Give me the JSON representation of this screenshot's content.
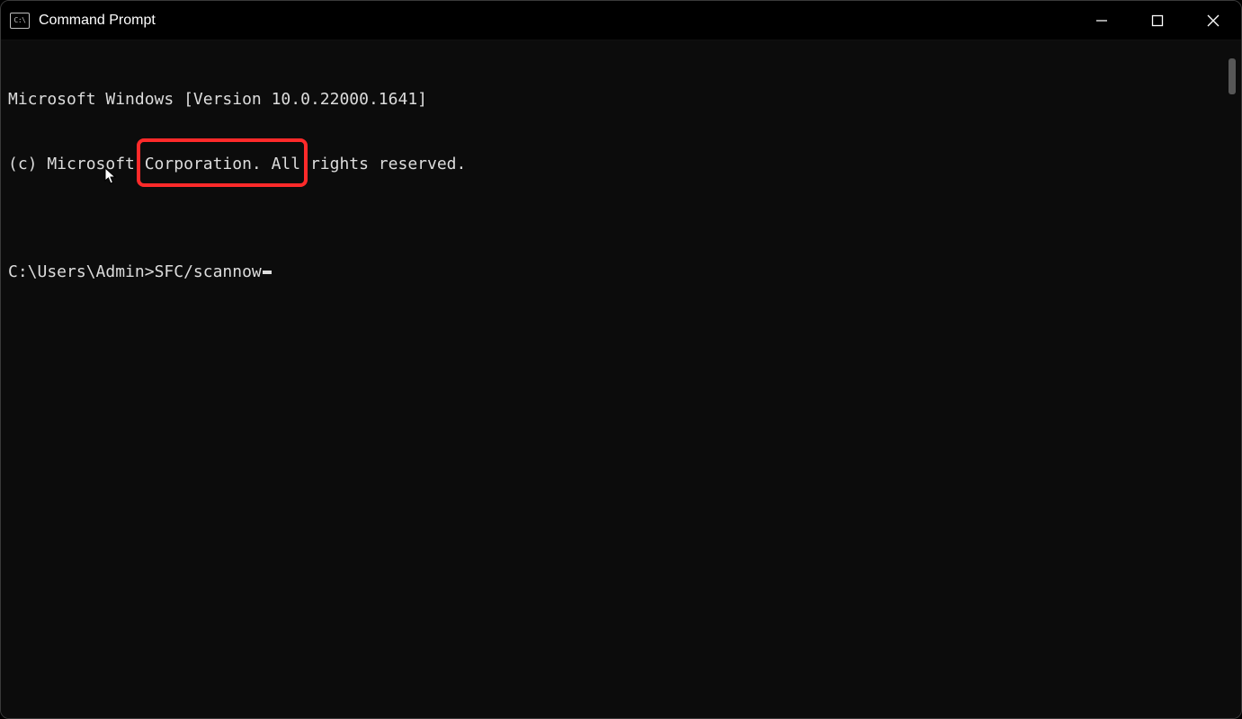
{
  "titlebar": {
    "icon_label": "C:\\",
    "title": "Command Prompt",
    "controls": {
      "minimize": "minimize",
      "maximize": "maximize",
      "close": "close"
    }
  },
  "terminal": {
    "line1": "Microsoft Windows [Version 10.0.22000.1641]",
    "line2": "(c) Microsoft Corporation. All rights reserved.",
    "blank": "",
    "prompt": "C:\\Users\\Admin>",
    "command": "SFC/scannow"
  },
  "annotation": {
    "highlight_color": "#ff2a2a"
  }
}
